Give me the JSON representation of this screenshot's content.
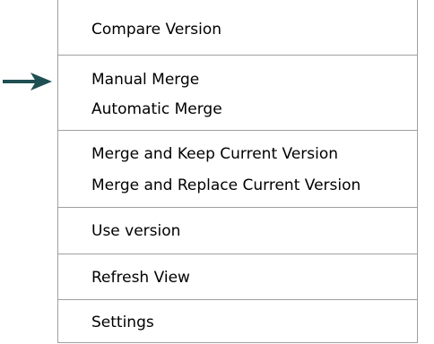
{
  "pointer": {
    "icon": "arrow-right-icon",
    "color": "#1f4f52"
  },
  "menu": {
    "items": [
      {
        "label": "Compare Version"
      },
      {
        "label": "Manual Merge"
      },
      {
        "label": "Automatic Merge"
      },
      {
        "label": "Merge and Keep Current Version"
      },
      {
        "label": "Merge and Replace Current Version"
      },
      {
        "label": "Use version"
      },
      {
        "label": "Refresh View"
      },
      {
        "label": "Settings"
      }
    ]
  }
}
